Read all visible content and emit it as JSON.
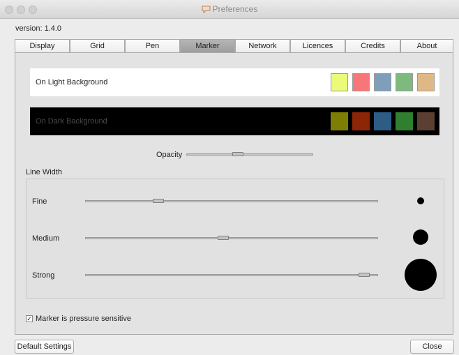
{
  "window": {
    "title": "Preferences"
  },
  "version_text": "version: 1.4.0",
  "tabs": [
    "Display",
    "Grid",
    "Pen",
    "Marker",
    "Network",
    "Licences",
    "Credits",
    "About"
  ],
  "active_tab": "Marker",
  "light_background": {
    "label": "On Light Background",
    "colors": [
      "#ebfb77",
      "#f77778",
      "#7e9eba",
      "#7eba7e",
      "#e0b886"
    ]
  },
  "dark_background": {
    "label": "On Dark Background",
    "colors": [
      "#7e7e05",
      "#8c2607",
      "#2d5c87",
      "#2f7f2f",
      "#5b4031"
    ]
  },
  "opacity": {
    "label": "Opacity",
    "value": 0.4
  },
  "line_width": {
    "title": "Line Width",
    "rows": [
      {
        "label": "Fine",
        "value": 0.24
      },
      {
        "label": "Medium",
        "value": 0.47
      },
      {
        "label": "Strong",
        "value": 0.97
      }
    ]
  },
  "pressure": {
    "label": "Marker is pressure sensitive",
    "checked": true,
    "mark": "✓"
  },
  "buttons": {
    "default": "Default Settings",
    "close": "Close"
  },
  "icons": {
    "title": "chat-bubble-icon",
    "check": "checkmark-icon"
  }
}
